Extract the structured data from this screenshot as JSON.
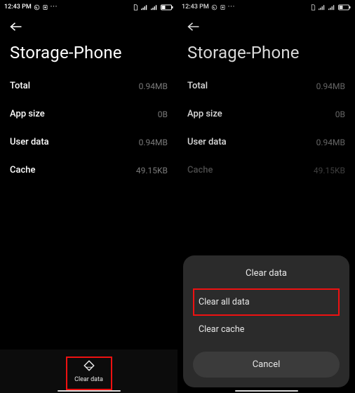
{
  "status": {
    "time": "12:43 PM",
    "left_icons": [
      "whatsapp-icon",
      "screenshot-icon",
      "more-icon"
    ],
    "right_icons": [
      "sim-icon",
      "wifi-icon",
      "signal-icon",
      "battery-icon"
    ]
  },
  "page_title": "Storage-Phone",
  "rows": [
    {
      "label": "Total",
      "value": "0.94MB"
    },
    {
      "label": "App size",
      "value": "0B"
    },
    {
      "label": "User data",
      "value": "0.94MB"
    },
    {
      "label": "Cache",
      "value": "49.15KB"
    }
  ],
  "bottom_action": {
    "label": "Clear data"
  },
  "sheet": {
    "title": "Clear data",
    "options": [
      "Clear all data",
      "Clear cache"
    ],
    "cancel": "Cancel"
  },
  "highlights": {
    "left_bottom_button": true,
    "sheet_option_index": 0
  },
  "colors": {
    "highlight": "#ee1111"
  }
}
